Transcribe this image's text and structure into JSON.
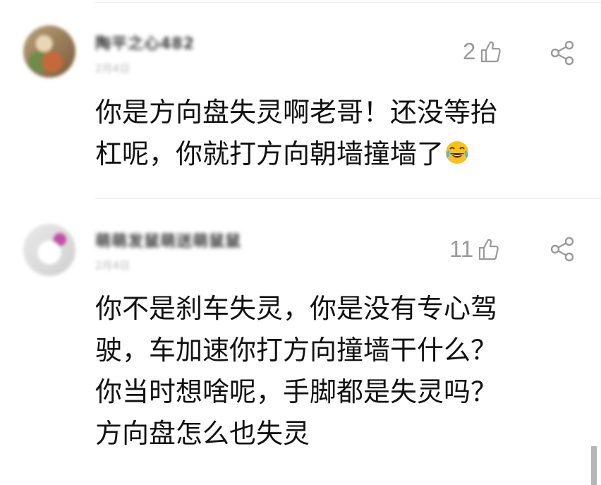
{
  "comments": [
    {
      "username": "陶平之心482",
      "meta": "2月4日",
      "likes": "2",
      "text_line1": "你是方向盘失灵啊老哥！还没等抬",
      "text_line2": "杠呢，你就打方向朝墙撞墙了",
      "emoji": "laughing-tears"
    },
    {
      "username": "萌萌发鼠萌送萌鼠鼠",
      "meta": "2月4日",
      "likes": "11",
      "text_line1": "你不是刹车失灵，你是没有专心驾",
      "text_line2": "驶，车加速你打方向撞墙干什么？",
      "text_line3": "你当时想啥呢，手脚都是失灵吗？",
      "text_line4": "方向盘怎么也失灵"
    }
  ],
  "icons": {
    "like": "thumbs-up-outline",
    "share": "share-nodes",
    "emoji": "face-with-tears-of-joy"
  },
  "colors": {
    "text": "#111111",
    "secondary": "#9a9a9a",
    "divider": "#ececec"
  }
}
